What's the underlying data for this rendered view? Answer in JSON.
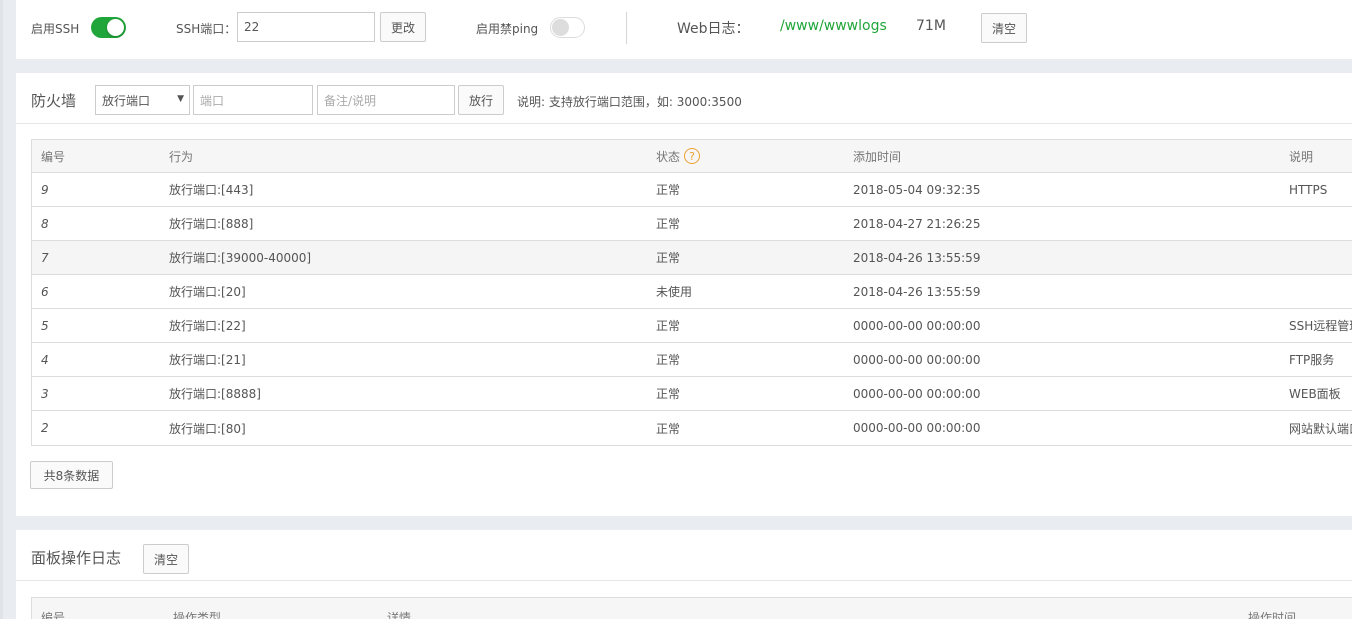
{
  "top_panel": {
    "ssh_toggle_label": "启用SSH",
    "ssh_enabled": true,
    "ssh_port_label": "SSH端口：",
    "ssh_port_value": "22",
    "change_button": "更改",
    "ping_toggle_label": "启用禁ping",
    "ping_block_enabled": false,
    "web_log_label": "Web日志：",
    "web_log_path": "/www/wwwlogs",
    "web_log_size": "71M",
    "clear_button": "清空"
  },
  "firewall": {
    "title": "防火墙",
    "action_select": "放行端口",
    "port_placeholder": "端口",
    "note_placeholder": "备注/说明",
    "allow_button": "放行",
    "hint": "说明: 支持放行端口范围，如: 3000:3500",
    "columns": [
      "编号",
      "行为",
      "状态",
      "添加时间",
      "说明"
    ],
    "status_help_icon": "?",
    "rows": [
      {
        "id": "9",
        "action": "放行端口:[443]",
        "status": "正常",
        "time": "2018-05-04 09:32:35",
        "note": "HTTPS"
      },
      {
        "id": "8",
        "action": "放行端口:[888]",
        "status": "正常",
        "time": "2018-04-27 21:26:25",
        "note": ""
      },
      {
        "id": "7",
        "action": "放行端口:[39000-40000]",
        "status": "正常",
        "time": "2018-04-26 13:55:59",
        "note": ""
      },
      {
        "id": "6",
        "action": "放行端口:[20]",
        "status": "未使用",
        "time": "2018-04-26 13:55:59",
        "note": ""
      },
      {
        "id": "5",
        "action": "放行端口:[22]",
        "status": "正常",
        "time": "0000-00-00 00:00:00",
        "note": "SSH远程管理"
      },
      {
        "id": "4",
        "action": "放行端口:[21]",
        "status": "正常",
        "time": "0000-00-00 00:00:00",
        "note": "FTP服务"
      },
      {
        "id": "3",
        "action": "放行端口:[8888]",
        "status": "正常",
        "time": "0000-00-00 00:00:00",
        "note": "WEB面板"
      },
      {
        "id": "2",
        "action": "放行端口:[80]",
        "status": "正常",
        "time": "0000-00-00 00:00:00",
        "note": "网站默认端口"
      }
    ],
    "total": "共8条数据"
  },
  "panel_log": {
    "title": "面板操作日志",
    "clear_button": "清空",
    "columns": [
      "编号",
      "操作类型",
      "详情",
      "操作时间"
    ]
  },
  "colors": {
    "accent_green": "#20a53a",
    "link_green": "#20a53a",
    "help_orange": "#f0a030"
  }
}
